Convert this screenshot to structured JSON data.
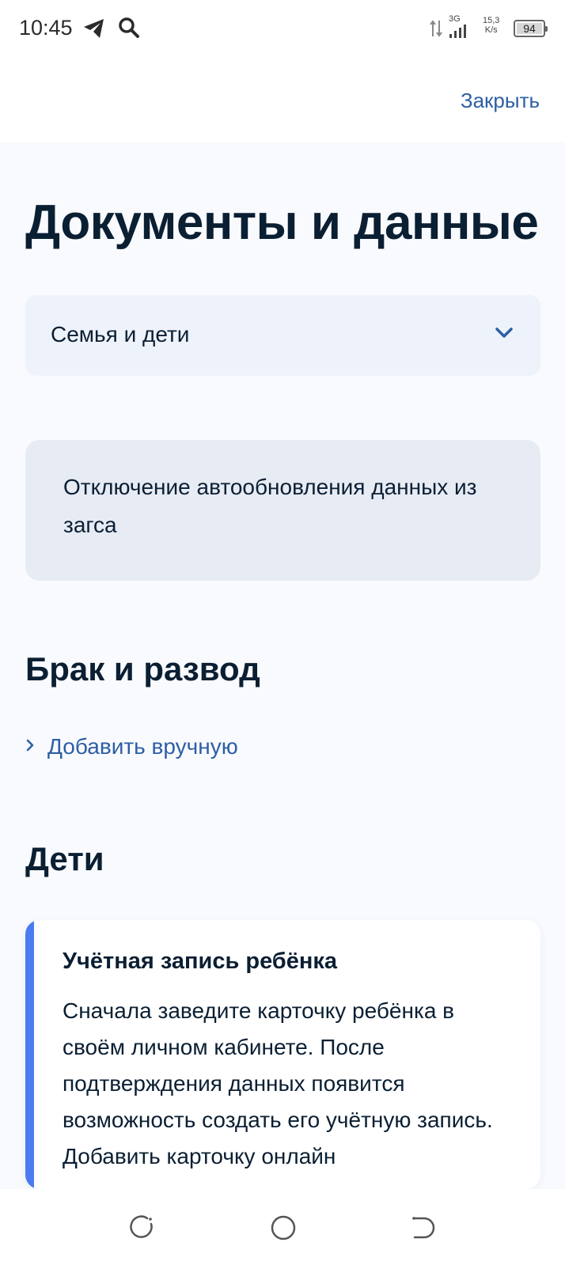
{
  "status_bar": {
    "time": "10:45",
    "network_type": "3G",
    "speed_value": "15,3",
    "speed_unit": "K/s",
    "battery": "94"
  },
  "header": {
    "close_label": "Закрыть"
  },
  "page": {
    "title": "Документы и данные"
  },
  "category_select": {
    "value": "Семья и дети"
  },
  "info_card": {
    "text": "Отключение автообновления данных из загса"
  },
  "sections": {
    "marriage": {
      "title": "Брак и развод",
      "add_manual_label": "Добавить вручную"
    },
    "children": {
      "title": "Дети",
      "card_title": "Учётная запись ребёнка",
      "card_text": "Сначала заведите карточку ребёнка в своём личном кабинете. После подтверждения данных появится возможность создать его учётную запись. Добавить карточку онлайн"
    }
  },
  "colors": {
    "link": "#2d5fa4",
    "accent": "#4b7bf0",
    "text": "#0b1f33",
    "background": "#f8fafe"
  },
  "icons": {
    "status": [
      "telegram-icon",
      "search-icon",
      "data-arrows-icon",
      "signal-icon",
      "battery-icon"
    ],
    "select": "chevron-down-icon",
    "link": "chevron-right-icon",
    "nav": [
      "recents-icon",
      "home-icon",
      "back-icon"
    ]
  }
}
